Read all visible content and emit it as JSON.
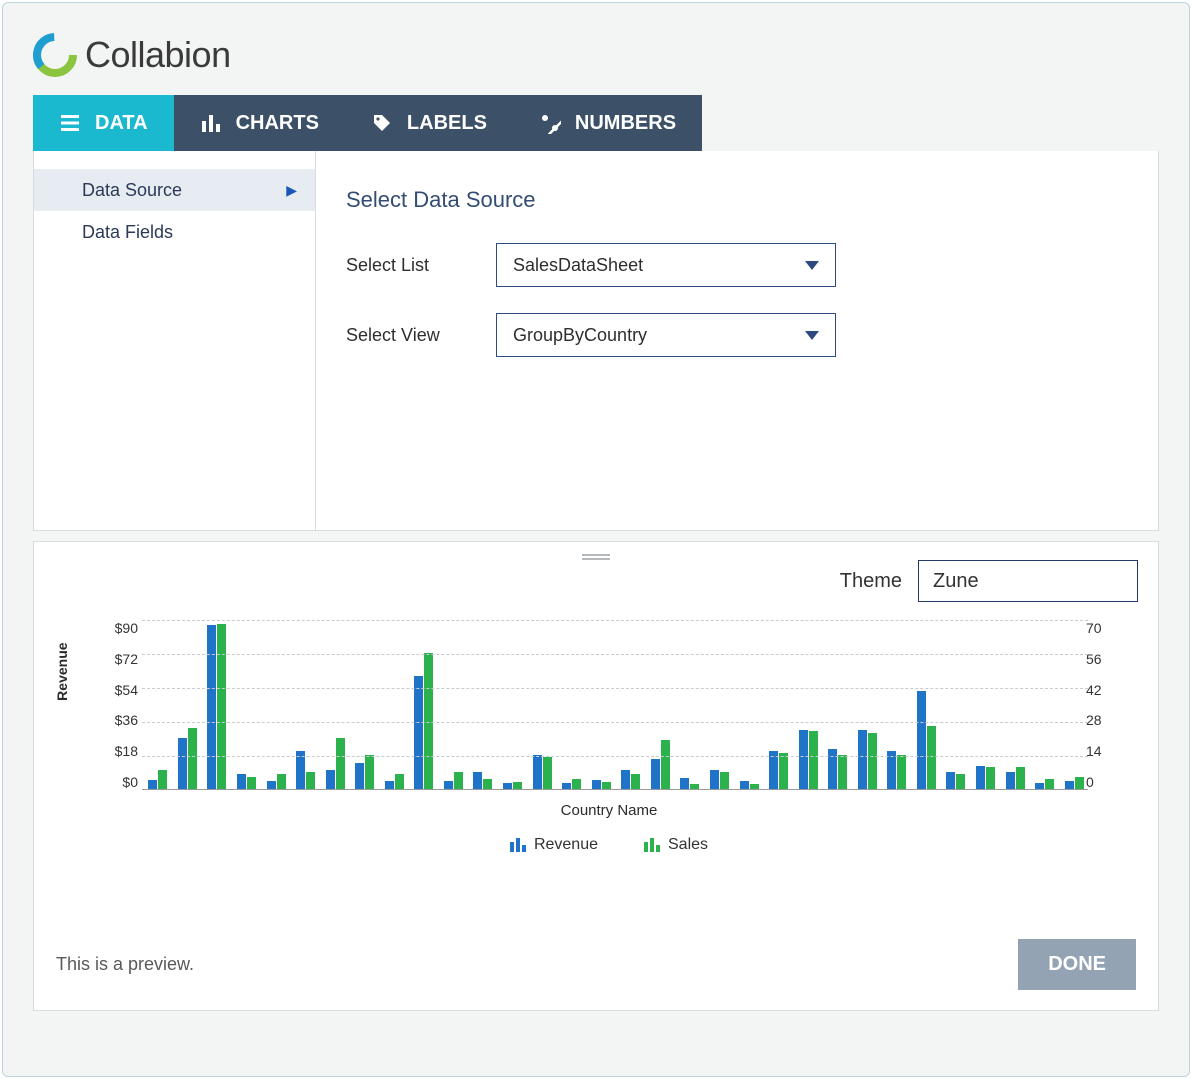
{
  "brand": "Collabion",
  "tabs": [
    {
      "id": "data",
      "label": "DATA",
      "icon": "menu-icon",
      "active": true
    },
    {
      "id": "charts",
      "label": "CHARTS",
      "icon": "bars-icon",
      "active": false
    },
    {
      "id": "labels",
      "label": "LABELS",
      "icon": "tag-icon",
      "active": false
    },
    {
      "id": "numbers",
      "label": "NUMBERS",
      "icon": "percent-icon",
      "active": false
    }
  ],
  "sidebar": {
    "items": [
      {
        "label": "Data Source",
        "active": true
      },
      {
        "label": "Data Fields",
        "active": false
      }
    ]
  },
  "form": {
    "title": "Select Data Source",
    "list_label": "Select List",
    "list_value": "SalesDataSheet",
    "view_label": "Select View",
    "view_value": "GroupByCountry"
  },
  "preview": {
    "theme_label": "Theme",
    "theme_value": "Zune",
    "note": "This is a preview.",
    "done_label": "DONE"
  },
  "chart_data": {
    "type": "bar",
    "xlabel": "Country Name",
    "ylabel": "Revenue",
    "left_axis_ticks": [
      "$90",
      "$72",
      "$54",
      "$36",
      "$18",
      "$0"
    ],
    "right_axis_ticks": [
      "70",
      "56",
      "42",
      "28",
      "14",
      "0"
    ],
    "ylim_left": [
      0,
      90
    ],
    "ylim_right": [
      0,
      70
    ],
    "series": [
      {
        "name": "Revenue",
        "color": "#1f74c7",
        "axis": "left",
        "values": [
          5,
          27,
          87,
          8,
          4,
          20,
          10,
          14,
          4,
          60,
          4,
          9,
          3,
          18,
          3,
          5,
          10,
          16,
          6,
          10,
          4,
          20,
          31,
          21,
          31,
          20,
          52,
          9,
          12,
          9,
          3,
          4
        ]
      },
      {
        "name": "Sales",
        "color": "#2bb24c",
        "axis": "right",
        "values": [
          8,
          25,
          68,
          5,
          6,
          7,
          21,
          14,
          6,
          56,
          7,
          4,
          3,
          13,
          4,
          3,
          6,
          20,
          2,
          7,
          2,
          15,
          24,
          14,
          23,
          14,
          26,
          6,
          9,
          9,
          4,
          5
        ]
      }
    ],
    "legend": [
      "Revenue",
      "Sales"
    ]
  }
}
